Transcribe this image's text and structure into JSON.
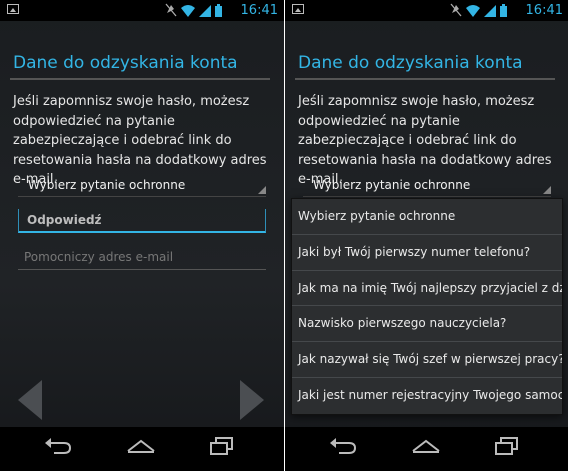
{
  "status_bar": {
    "time": "16:41",
    "icons": [
      "image-notification-icon",
      "mute-icon",
      "wifi-icon",
      "signal-icon",
      "battery-icon"
    ]
  },
  "page": {
    "title": "Dane do odzyskania konta",
    "description": "Jeśli zapomnisz swoje hasło, możesz odpowiedzieć na pytanie zabezpieczające i odebrać link do resetowania hasła na dodatkowy adres e-mail.",
    "question_spinner": "Wybierz pytanie ochronne",
    "answer_placeholder": "Odpowiedź",
    "email_placeholder": "Pomocniczy adres e-mail"
  },
  "dropdown": {
    "options": [
      "Wybierz pytanie ochronne",
      "Jaki był Twój pierwszy numer telefonu?",
      "Jak ma na imię Twój najlepszy przyjaciel z dzie...",
      "Nazwisko pierwszego nauczyciela?",
      "Jak nazywał się Twój szef w pierwszej pracy?",
      "Jaki jest numer rejestracyjny Twojego samocho..."
    ]
  },
  "colors": {
    "accent": "#33b5e5",
    "background": "#1e2124",
    "text": "#e6e6e6"
  }
}
